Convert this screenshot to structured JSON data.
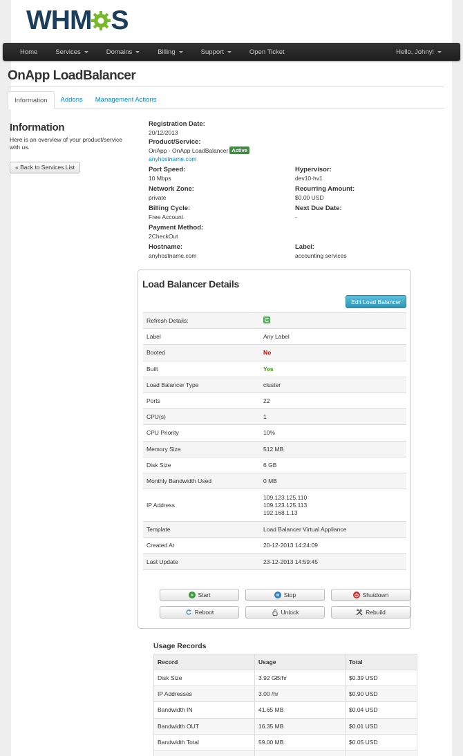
{
  "logo": {
    "text_left": "WHM",
    "text_right": "S"
  },
  "nav": {
    "items": [
      {
        "label": "Home",
        "dropdown": false
      },
      {
        "label": "Services",
        "dropdown": true
      },
      {
        "label": "Domains",
        "dropdown": true
      },
      {
        "label": "Billing",
        "dropdown": true
      },
      {
        "label": "Support",
        "dropdown": true
      },
      {
        "label": "Open Ticket",
        "dropdown": false
      }
    ],
    "user_label": "Hello, Johny!"
  },
  "page_title": "OnApp LoadBalancer",
  "tabs": [
    {
      "label": "Information",
      "active": true
    },
    {
      "label": "Addons",
      "active": false
    },
    {
      "label": "Management Actions",
      "active": false
    }
  ],
  "sidebar": {
    "title": "Information",
    "description": "Here is an overview of your product/service with us.",
    "back_button": "« Back to Services List"
  },
  "info": {
    "registration_date_label": "Registration Date:",
    "registration_date": "20/12/2013",
    "product_label": "Product/Service:",
    "product": "OnApp - OnApp LoadBalancer",
    "status_badge": "Active",
    "product_link": "anyhostname.com",
    "port_speed_label": "Port Speed:",
    "port_speed": "10 Mbps",
    "hypervisor_label": "Hypervisor:",
    "hypervisor": "dev10-hv1",
    "network_zone_label": "Network Zone:",
    "network_zone": "private",
    "recurring_amount_label": "Recurring Amount:",
    "recurring_amount": "$0.00 USD",
    "billing_cycle_label": "Billing Cycle:",
    "billing_cycle": "Free Account",
    "next_due_label": "Next Due Date:",
    "next_due": "-",
    "payment_method_label": "Payment Method:",
    "payment_method": "2CheckOut",
    "hostname_label": "Hostname:",
    "hostname": "anyhostname.com",
    "label_label": "Label:",
    "label": "accounting services"
  },
  "lb": {
    "title": "Load Balancer Details",
    "edit_button": "Edit Load Balancer",
    "rows": [
      {
        "key": "Refresh Details:",
        "value": "",
        "type": "icon"
      },
      {
        "key": "Label",
        "value": "Any Label",
        "type": "text"
      },
      {
        "key": "Booted",
        "value": "No",
        "type": "red"
      },
      {
        "key": "Built",
        "value": "Yes",
        "type": "green"
      },
      {
        "key": "Load Balancer Type",
        "value": "cluster",
        "type": "text"
      },
      {
        "key": "Ports",
        "value": "22",
        "type": "text"
      },
      {
        "key": "CPU(s)",
        "value": "1",
        "type": "text"
      },
      {
        "key": "CPU Priority",
        "value": "10%",
        "type": "text"
      },
      {
        "key": "Memory Size",
        "value": "512 MB",
        "type": "text"
      },
      {
        "key": "Disk Size",
        "value": "6 GB",
        "type": "text"
      },
      {
        "key": "Monthly Bandwidth Used",
        "value": "0 MB",
        "type": "text"
      },
      {
        "key": "IP Address",
        "value": [
          "109.123.125.110",
          "109.123.125.113",
          "192.168.1.13"
        ],
        "type": "multi"
      },
      {
        "key": "Template",
        "value": "Load Balancer Virtual Appliance",
        "type": "text"
      },
      {
        "key": "Created At",
        "value": "20-12-2013 14:24:09",
        "type": "text"
      },
      {
        "key": "Last Update",
        "value": "23-12-2013 14:59:45",
        "type": "text"
      }
    ],
    "actions": {
      "start": "Start",
      "stop": "Stop",
      "shutdown": "Shutdown",
      "reboot": "Reboot",
      "unlock": "Unlock",
      "rebuild": "Rebuild"
    }
  },
  "usage": {
    "title": "Usage Records",
    "headers": [
      "Record",
      "Usage",
      "Total"
    ],
    "rows": [
      [
        "Disk Size",
        "3.92 GB/hr",
        "$0.39 USD"
      ],
      [
        "IP Addresses",
        "3.00 /hr",
        "$0.90 USD"
      ],
      [
        "Bandwidth IN",
        "41.65 MB",
        "$0.04 USD"
      ],
      [
        "Bandwidth OUT",
        "16.35 MB",
        "$0.01 USD"
      ],
      [
        "Bandwidth Total",
        "59.00 MB",
        "$0.05 USD"
      ],
      [
        "",
        "",
        ""
      ]
    ]
  },
  "colors": {
    "brand_dark": "#1a3e5c",
    "brand_green": "#76b82a",
    "link": "#0088cc",
    "active_badge": "#468847",
    "info_button": "#2f96b4"
  }
}
